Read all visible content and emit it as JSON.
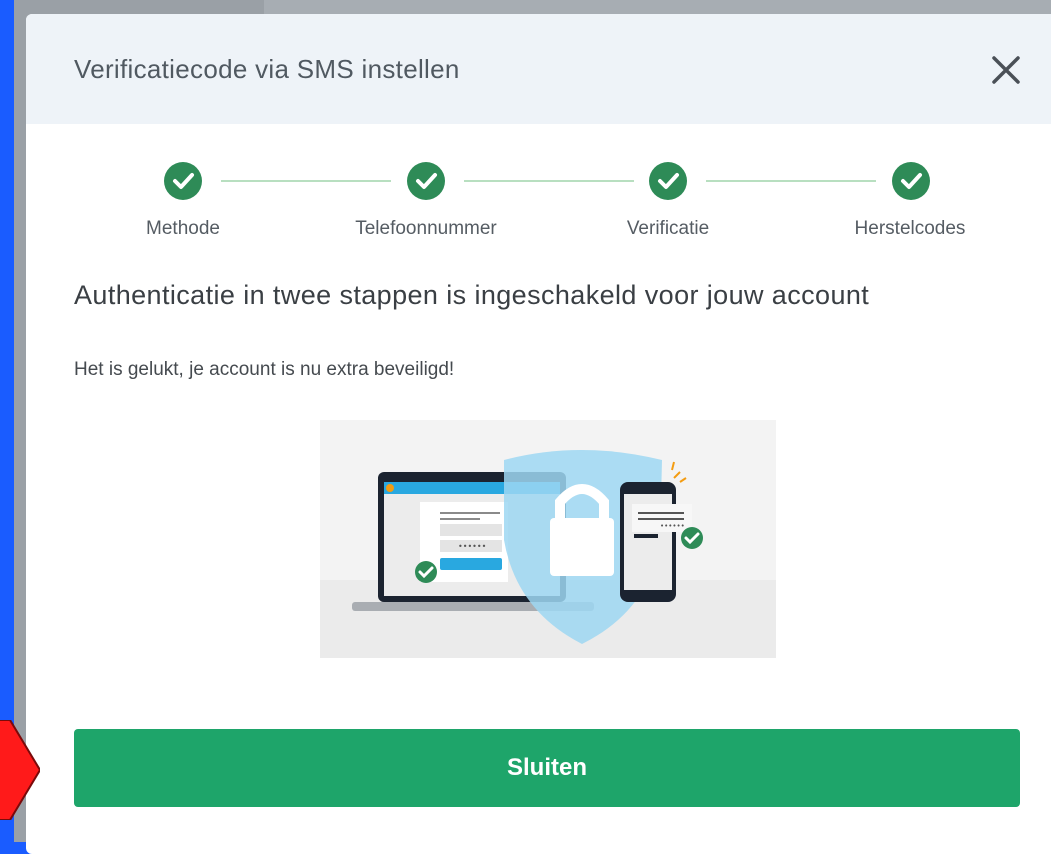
{
  "modal": {
    "title": "Verificatiecode via SMS instellen",
    "close_icon": "close-icon"
  },
  "stepper": {
    "steps": [
      {
        "label": "Methode",
        "status": "completed"
      },
      {
        "label": "Telefoonnummer",
        "status": "completed"
      },
      {
        "label": "Verificatie",
        "status": "completed"
      },
      {
        "label": "Herstelcodes",
        "status": "completed"
      }
    ]
  },
  "content": {
    "heading": "Authenticatie in twee stappen is ingeschakeld voor jouw account",
    "message": "Het is gelukt, je account is nu extra beveiligd!",
    "illustration_password_mask": "••••••"
  },
  "actions": {
    "close_label": "Sluiten"
  },
  "colors": {
    "accent": "#1ea56a",
    "step_check": "#2e8b57",
    "header_bg": "#eef3f8",
    "page_bg": "#1a5cff",
    "pointer_arrow": "#ff1a1a"
  }
}
